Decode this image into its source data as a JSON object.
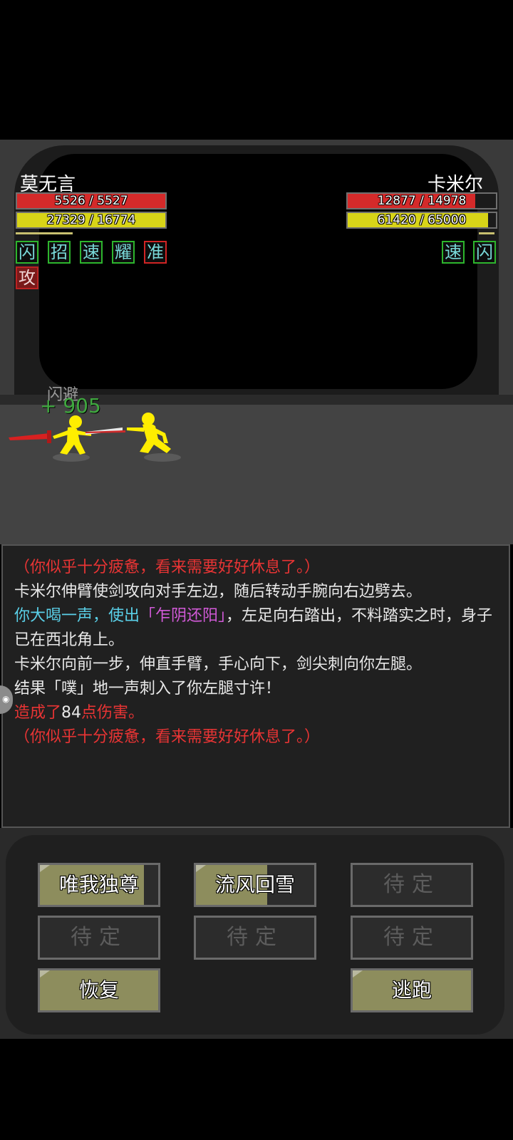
{
  "player": {
    "name": "莫无言",
    "hp_text": "5526 / 5527",
    "hp_fraction": 0.999,
    "mp_text": "27329 / 16774",
    "mp_fraction": 1.0,
    "buffs": [
      "闪",
      "招",
      "速",
      "耀",
      "准",
      "攻"
    ]
  },
  "enemy": {
    "name": "卡米尔",
    "hp_text": "12877 / 14978",
    "hp_fraction": 0.86,
    "mp_text": "61420 / 65000",
    "mp_fraction": 0.945,
    "buffs": [
      "速",
      "闪"
    ]
  },
  "floating": {
    "dodge": "闪避",
    "heal": "+ 905"
  },
  "log": {
    "lines": [
      {
        "text": "（你似乎十分疲惫，看来需要好好休息了。）",
        "color": "red"
      },
      {
        "text": "卡米尔伸臂使剑攻向对手左边，随后转动手腕向右边劈去。",
        "color": "white"
      },
      {
        "pre": "你大喝一声，使出",
        "skill": "「乍阴还阳」",
        "post": "，左足向右踏出，不料踏实之时，身子已在西北角上。"
      },
      {
        "text": "卡米尔向前一步，伸直手臂，手心向下，剑尖刺向你左腿。",
        "color": "white"
      },
      {
        "text": "结果「噗」地一声刺入了你左腿寸许！",
        "color": "white"
      },
      {
        "pre": "造成了",
        "num": "84",
        "post": "点伤害。"
      },
      {
        "text": "（你似乎十分疲惫，看来需要好好休息了。）",
        "color": "red"
      }
    ]
  },
  "skills": {
    "skill1": "唯我独尊",
    "skill1_fill": 0.88,
    "skill2": "流风回雪",
    "skill2_fill": 0.6,
    "empty": "待定",
    "recover": "恢复",
    "flee": "逃跑"
  },
  "colors": {
    "hp": "#d42a2a",
    "mp": "#d8d418",
    "buff_border": "#2db52d",
    "log_red": "#e83434",
    "log_cyan": "#5ad0e8",
    "log_magenta": "#d25ad8",
    "button_fill": "#8d8d5d"
  }
}
